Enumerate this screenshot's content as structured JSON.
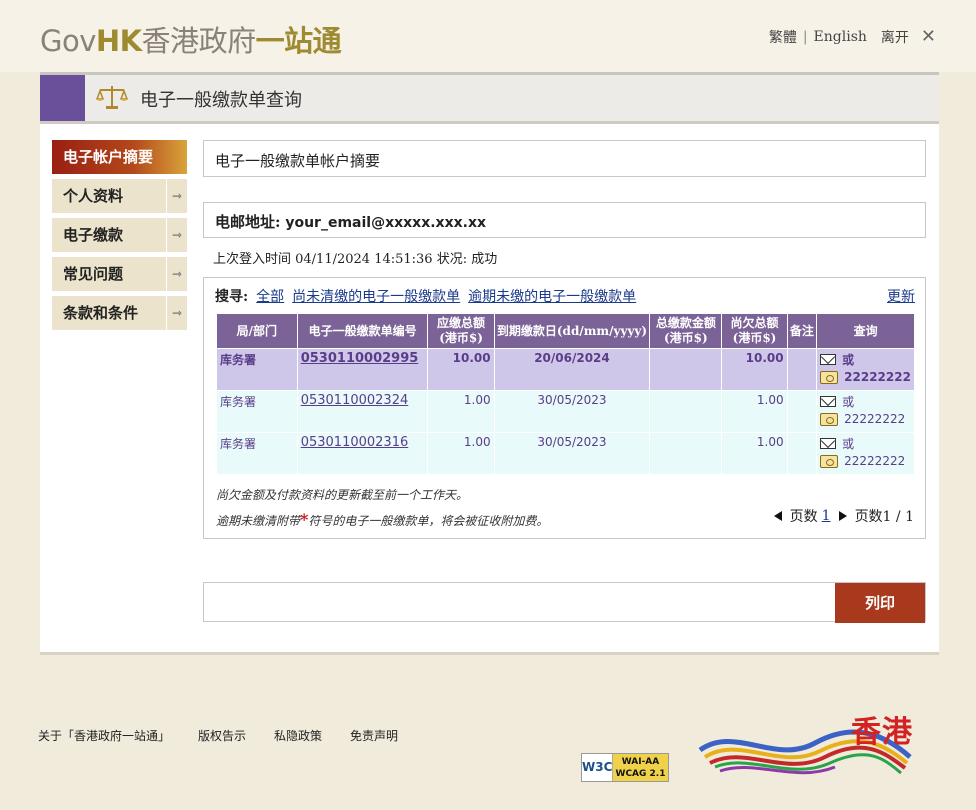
{
  "header": {
    "logo_gov": "Gov",
    "logo_hk": "HK",
    "logo_cn1": "香港政府",
    "logo_cn2": "一站通",
    "lang_trad": "繁體",
    "lang_sep": "|",
    "lang_en": "English",
    "exit": "离开",
    "close_glyph": "✕"
  },
  "title_bar": {
    "title": "电子一般缴款单查询"
  },
  "sidebar": {
    "items": [
      {
        "label": "电子帐户摘要",
        "active": true
      },
      {
        "label": "个人资料",
        "arrow": "⇾"
      },
      {
        "label": "电子缴款",
        "arrow": "⇾"
      },
      {
        "label": "常见问题",
        "arrow": "⇾"
      },
      {
        "label": "条款和条件",
        "arrow": "⇾"
      }
    ]
  },
  "main": {
    "section_title": "电子一般缴款单帐户摘要",
    "email_label": "电邮地址:",
    "email_value": "your_email@xxxxx.xxx.xx",
    "last_login": "上次登入时间 04/11/2024 14:51:36 状况: 成功",
    "search": {
      "label": "搜寻:",
      "links": [
        "全部",
        "尚未清缴的电子一般缴款单",
        "逾期未缴的电子一般缴款单"
      ],
      "refresh": "更新"
    },
    "table": {
      "headers": [
        "局/部门",
        "电子一般缴款单编号",
        "应缴总额 (港币$)",
        "到期缴款日(dd/mm/yyyy)",
        "总缴款金额 (港币$)",
        "尚欠总额 (港币$)",
        "备注",
        "查询"
      ],
      "rows": [
        {
          "dept": "库务署",
          "number": "0530110002995",
          "amount": "10.00",
          "due": "20/06/2024",
          "paid": "",
          "outstanding": "10.00",
          "remark": "",
          "or": "或",
          "phone": "22222222"
        },
        {
          "dept": "库务署",
          "number": "0530110002324",
          "amount": "1.00",
          "due": "30/05/2023",
          "paid": "",
          "outstanding": "1.00",
          "remark": "",
          "or": "或",
          "phone": "22222222"
        },
        {
          "dept": "库务署",
          "number": "0530110002316",
          "amount": "1.00",
          "due": "30/05/2023",
          "paid": "",
          "outstanding": "1.00",
          "remark": "",
          "or": "或",
          "phone": "22222222"
        }
      ]
    },
    "note1": "尚欠金额及付款资料的更新截至前一个工作天。",
    "note2_a": "逾期未缴清附带",
    "note2_star": "*",
    "note2_b": "符号的电子一般缴款单，将会被征收附加费。",
    "pager": {
      "label": "页数",
      "current": "1",
      "summary": "页数1 / 1"
    },
    "print": "列印"
  },
  "footer": {
    "links": [
      "关于「香港政府一站通」",
      "版权告示",
      "私隐政策",
      "免责声明"
    ],
    "w3c_a": "W3C",
    "w3c_b1": "WAI-AA",
    "w3c_b2": "WCAG 2.1",
    "brand_text": "香港"
  }
}
